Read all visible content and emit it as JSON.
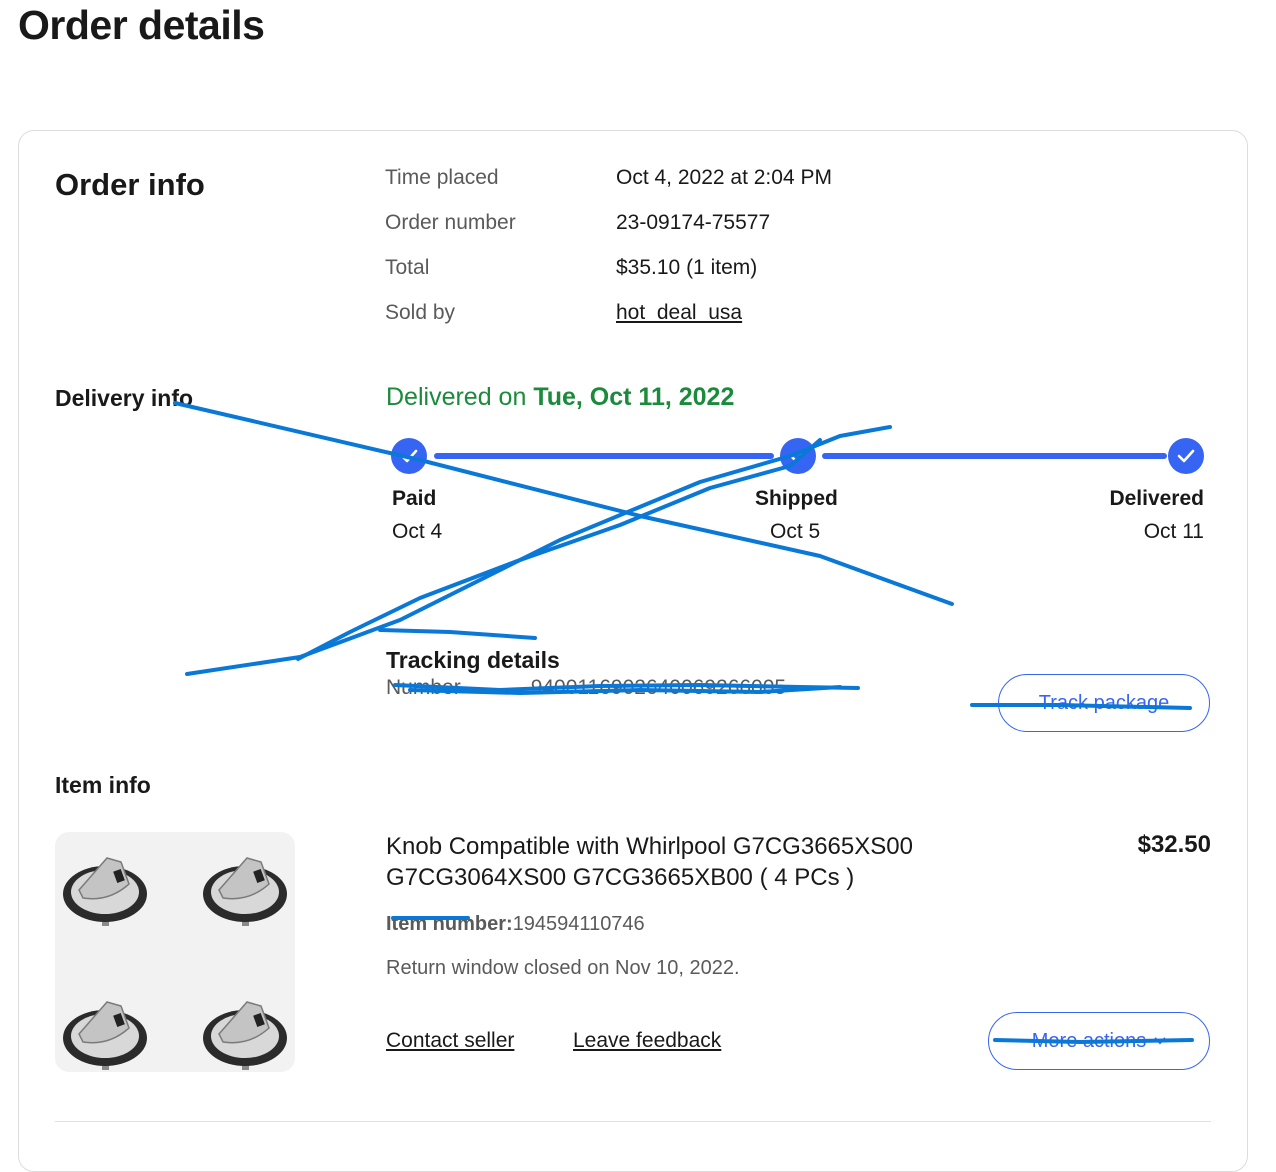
{
  "page": {
    "title": "Order details"
  },
  "order_info": {
    "heading": "Order info",
    "rows": [
      {
        "label": "Time placed",
        "value": "Oct 4, 2022 at 2:04 PM"
      },
      {
        "label": "Order number",
        "value": "23-09174-75577"
      },
      {
        "label": "Total",
        "value": "$35.10 (1 item)"
      },
      {
        "label": "Sold by",
        "value": "hot_deal_usa"
      }
    ]
  },
  "delivery_info": {
    "heading": "Delivery info",
    "status_prefix": "Delivered on",
    "status_date": "Tue, Oct 11, 2022",
    "steps": [
      {
        "label": "Paid",
        "date": "Oct 4"
      },
      {
        "label": "Shipped",
        "date": "Oct 5"
      },
      {
        "label": "Delivered",
        "date": "Oct 11"
      }
    ],
    "tracking_heading": "Tracking details",
    "tracking_label": "Number",
    "tracking_number": "9400116902640069266005",
    "track_button": "Track package"
  },
  "item_info": {
    "heading": "Item info",
    "title": "Knob Compatible with Whirlpool G7CG3665XS00 G7CG3064XS00 G7CG3665XB00 ( 4 PCs )",
    "price": "$32.50",
    "item_number_label": "Item number:",
    "item_number": "194594110746",
    "return_text": "Return window closed on Nov 10, 2022.",
    "contact_seller": "Contact seller",
    "leave_feedback": "Leave feedback",
    "more_actions": "More actions"
  },
  "colors": {
    "accent": "#3665f3",
    "delivered_green": "#1a8a3b",
    "scribble": "#0a78d7"
  },
  "icons": {
    "step": "check-icon",
    "more": "chevron-down-icon"
  }
}
